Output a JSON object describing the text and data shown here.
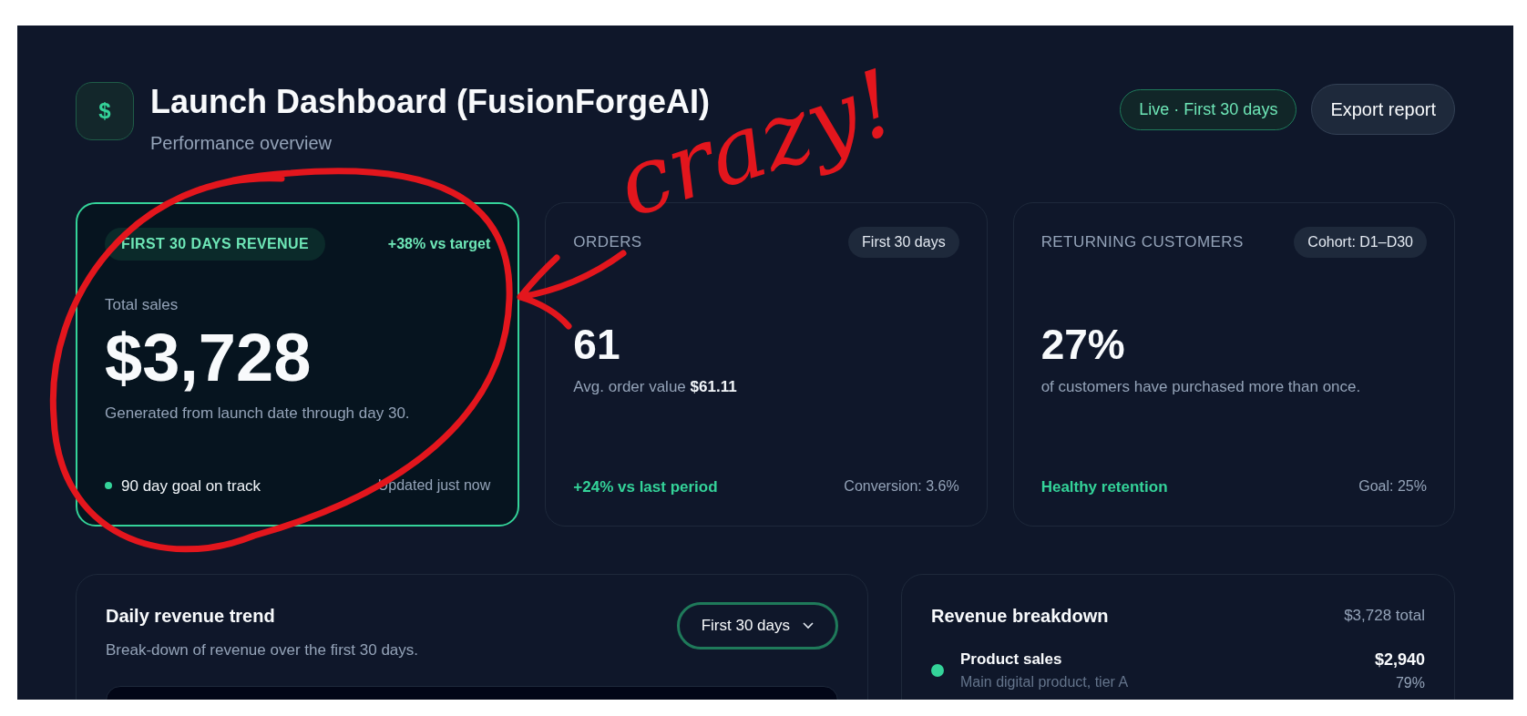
{
  "header": {
    "title": "Launch Dashboard (FusionForgeAI)",
    "subtitle": "Performance overview",
    "icon_glyph": "$",
    "live_badge": "Live · First 30 days",
    "export_button": "Export report"
  },
  "cards": [
    {
      "kind": "highlight",
      "label": "FIRST 30 DAYS REVENUE",
      "tag": "+38% vs target",
      "caption": "Total sales",
      "value": "$3,728",
      "description": "Generated from launch date through day 30.",
      "footer_left": "90 day goal on track",
      "footer_right": "Updated just now"
    },
    {
      "kind": "plain",
      "label": "ORDERS",
      "tag": "First 30 days",
      "value": "61",
      "description": "Avg. order value **$61.11**",
      "footer_left": "+24% vs last period",
      "footer_right": "Conversion: 3.6%"
    },
    {
      "kind": "plain",
      "label": "RETURNING CUSTOMERS",
      "tag": "Cohort: D1–D30",
      "value": "27%",
      "description": "of customers have purchased more than once.",
      "footer_left": "Healthy retention",
      "footer_right": "Goal: 25%"
    }
  ],
  "trend": {
    "title": "Daily revenue trend",
    "subtitle": "Break-down of revenue over the first 30 days.",
    "range_select": "First 30 days"
  },
  "breakdown": {
    "title": "Revenue breakdown",
    "total": "$3,728 total",
    "items": [
      {
        "name": "Product sales",
        "detail": "Main digital product, tier A",
        "amount": "$2,940",
        "share": "79%",
        "color": "#34d399"
      }
    ]
  },
  "annotation": {
    "text": "crazy!"
  }
}
